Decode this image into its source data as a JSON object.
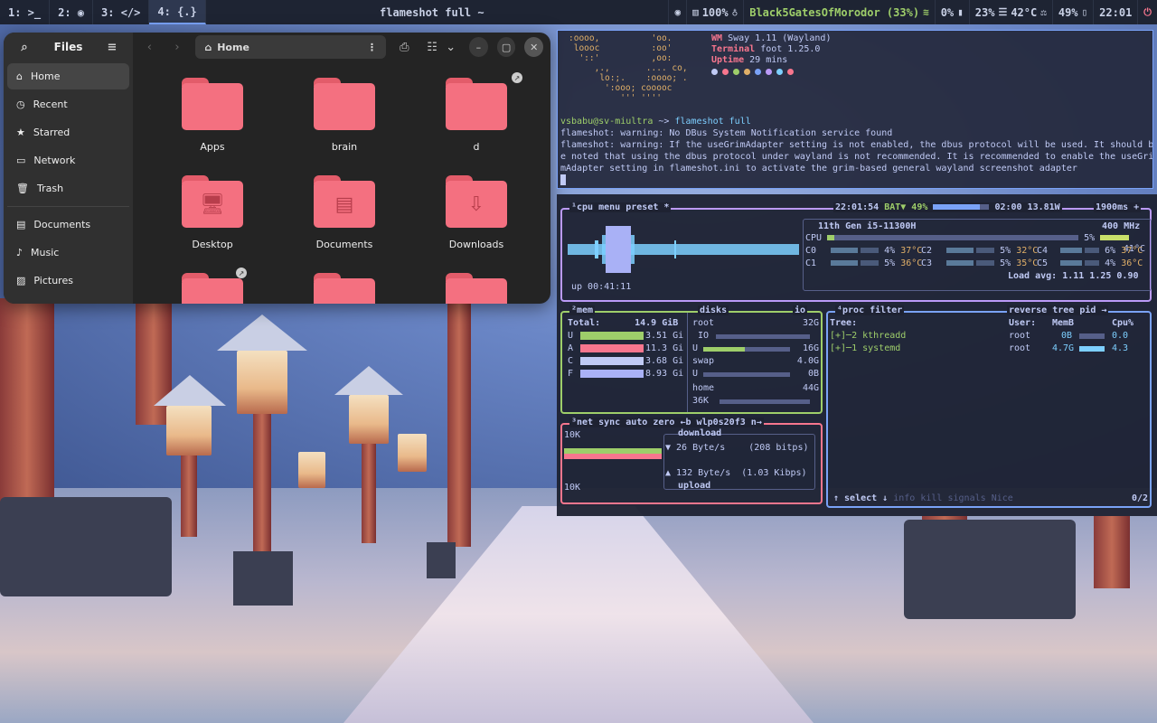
{
  "topbar": {
    "workspaces": [
      {
        "label": "1: >_"
      },
      {
        "label": "2: ◉"
      },
      {
        "label": "3: </>"
      },
      {
        "label": "4: {.}"
      }
    ],
    "window_title": "flameshot full ~",
    "volume": "100%",
    "wifi_name": "Black5GatesOfMorodor (33%)",
    "cpu_pct": "0%",
    "mem_pct": "23%",
    "temp": "42°C",
    "battery": "49%",
    "clock": "22:01"
  },
  "files": {
    "title": "Files",
    "sidebar": [
      {
        "label": "Home",
        "icon": "⌂"
      },
      {
        "label": "Recent",
        "icon": "◷"
      },
      {
        "label": "Starred",
        "icon": "★"
      },
      {
        "label": "Network",
        "icon": "▭"
      },
      {
        "label": "Trash",
        "icon": "🗑"
      },
      {
        "label": "Documents",
        "icon": "▤"
      },
      {
        "label": "Music",
        "icon": "♪"
      },
      {
        "label": "Pictures",
        "icon": "▨"
      }
    ],
    "path": "Home",
    "folders": [
      {
        "label": "Apps",
        "glyph": ""
      },
      {
        "label": "brain",
        "glyph": ""
      },
      {
        "label": "d",
        "glyph": ""
      },
      {
        "label": "Desktop",
        "glyph": "🖥"
      },
      {
        "label": "Documents",
        "glyph": "▤"
      },
      {
        "label": "Downloads",
        "glyph": "⇩"
      }
    ]
  },
  "terminal": {
    "ascii_art": ":oooo,          'oo.\n loooc          :oo'\n  '::'          ,oo:\n     ,.,       .... co,\n      lo:;.    :oooo; .\n       ':ooo; cooooc\n          ''' ''''",
    "fetch": [
      {
        "key": "WM",
        "value": "Sway 1.11 (Wayland)"
      },
      {
        "key": "Terminal",
        "value": "foot 1.25.0"
      },
      {
        "key": "Uptime",
        "value": "29 mins"
      }
    ],
    "dot_colors": [
      "#c0caf5",
      "#f7768e",
      "#9ece6a",
      "#e0af68",
      "#7aa2f7",
      "#bb9af7",
      "#7dcfff",
      "#f7768e"
    ],
    "prompt_user": "vsbabu@sv-miultra",
    "prompt_arrow": " ~> ",
    "command": "flameshot full",
    "line1": "flameshot: warning: No DBus System Notification service found",
    "line2": "flameshot: warning: If the useGrimAdapter setting is not enabled, the dbus protocol will be used. It should b",
    "line3": "e noted that using the dbus protocol under wayland is not recommended. It is recommended to enable the useGri",
    "line4": "mAdapter setting in flameshot.ini to activate the grim-based general wayland screenshot adapter"
  },
  "btop": {
    "cpu_title": "¹cpu",
    "menu": "menu",
    "preset": "preset *",
    "time": "22:01:54",
    "bat": "BAT▼ 49%",
    "bat_time": "02:00 13.81W",
    "interval": "1900ms +",
    "cpu_model": "11th Gen i5-11300H",
    "freq": "400 MHz",
    "cpu_total": {
      "label": "CPU",
      "pct": "5%",
      "temp": "41°C"
    },
    "cores": [
      {
        "label": "C0",
        "pct": "4%",
        "temp": "37°C"
      },
      {
        "label": "C2",
        "pct": "5%",
        "temp": "32°C"
      },
      {
        "label": "C4",
        "pct": "6%",
        "temp": "37°C"
      },
      {
        "label": "C1",
        "pct": "5%",
        "temp": "36°C"
      },
      {
        "label": "C3",
        "pct": "5%",
        "temp": "35°C"
      },
      {
        "label": "C5",
        "pct": "4%",
        "temp": "36°C"
      }
    ],
    "load_avg": "Load avg: 1.11 1.25 0.90",
    "uptime": "up 00:41:11",
    "mem_title": "²mem",
    "mem_total_label": "Total:",
    "mem_total": "14.9 GiB",
    "mem_rows": [
      {
        "label": "U",
        "value": "3.51 Gi",
        "color": "#9ece6a"
      },
      {
        "label": "A",
        "value": "11.3 Gi",
        "color": "#f7768e"
      },
      {
        "label": "C",
        "value": "3.68 Gi",
        "color": "#c0caf5"
      },
      {
        "label": "F",
        "value": "8.93 Gi",
        "color": "#a9b1f6"
      }
    ],
    "disks_title": "disks",
    "io_title": "io",
    "disks": [
      {
        "label": "root",
        "value": "32G"
      },
      {
        "label": "IO",
        "value": ""
      },
      {
        "label": "U",
        "value": "16G"
      },
      {
        "label": "swap",
        "value": "4.0G"
      },
      {
        "label": "U",
        "value": "0B"
      },
      {
        "label": "home",
        "value": "44G"
      },
      {
        "label": "36K",
        "value": ""
      }
    ],
    "proc_title": "⁴proc",
    "filter": "filter",
    "reverse": "reverse",
    "tree": "tree",
    "pid": "pid →",
    "proc_header": {
      "tree": "Tree:",
      "user": "User:",
      "mem": "MemB",
      "cpu": "Cpu%"
    },
    "procs": [
      {
        "name": "[+]─2  kthreadd",
        "user": "root",
        "mem": "0B",
        "cpu": "0.0"
      },
      {
        "name": "[+]─1  systemd",
        "user": "root",
        "mem": "4.7G",
        "cpu": "4.3"
      }
    ],
    "proc_footer": "↑ select ↓",
    "footer_info": "info",
    "footer_kill": "kill",
    "footer_signals": "signals",
    "footer_nice": "Nice",
    "proc_count": "0/2",
    "net_title": "³net",
    "sync": "sync",
    "auto": "auto",
    "zero": "zero",
    "iface": "←b wlp0s20f3 n→",
    "net_scale_top": "10K",
    "net_scale_bottom": "10K",
    "download_label": "download",
    "download_rate": "▼ 26 Byte/s",
    "download_bits": "(208 bitps)",
    "upload_rate": "▲ 132 Byte/s",
    "upload_bits": "(1.03 Kibps)",
    "upload_label": "upload"
  }
}
